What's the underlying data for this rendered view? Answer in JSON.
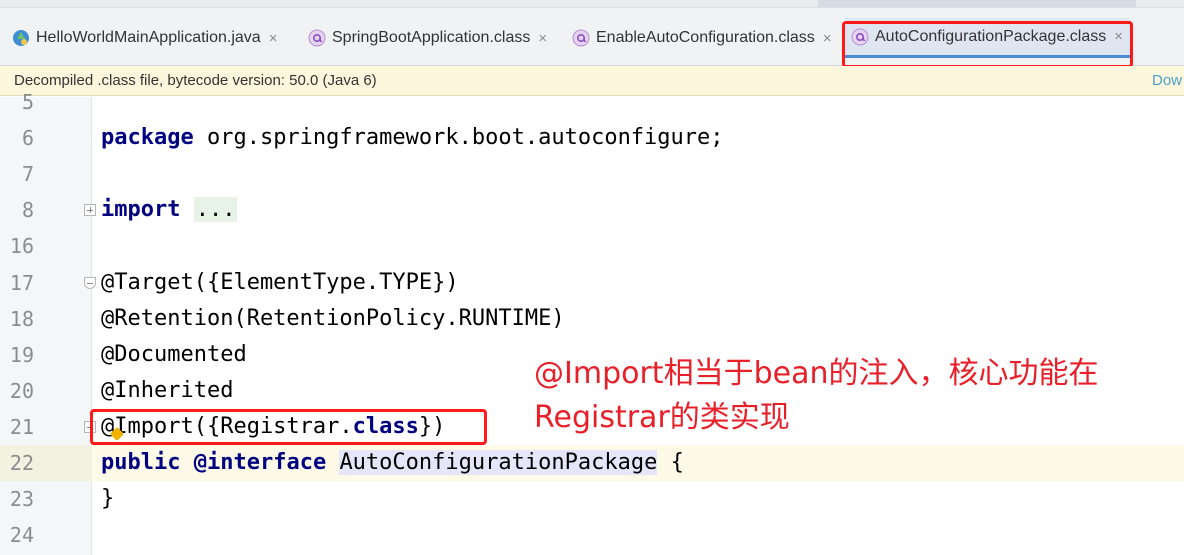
{
  "tabs": [
    {
      "label": "HelloWorldMainApplication.java",
      "icon": "java-class-icon",
      "active": false
    },
    {
      "label": "SpringBootApplication.class",
      "icon": "annotation-icon",
      "active": false
    },
    {
      "label": "EnableAutoConfiguration.class",
      "icon": "annotation-icon",
      "active": false
    },
    {
      "label": "AutoConfigurationPackage.class",
      "icon": "annotation-icon",
      "active": true
    }
  ],
  "close_glyph": "×",
  "banner": {
    "text": "Decompiled .class file, bytecode version: 50.0 (Java 6)",
    "link": "Dow"
  },
  "code": {
    "line_numbers": [
      "5",
      "6",
      "7",
      "8",
      "16",
      "17",
      "18",
      "19",
      "20",
      "21",
      "22",
      "23",
      "24"
    ],
    "package_kw": "package",
    "package_name": " org.springframework.boot.autoconfigure;",
    "import_kw": "import",
    "import_folded": "...",
    "target": "@Target({ElementType.TYPE})",
    "retention": "@Retention(RetentionPolicy.RUNTIME)",
    "documented": "@Documented",
    "inherited": "@Inherited",
    "import_anno_start": "@Import({Registrar.",
    "class_kw": "class",
    "import_anno_end": "})",
    "public_kw": "public",
    "interface_kw": "@interface",
    "interface_name": "AutoConfigurationPackage",
    "open_brace": " {",
    "close_brace": "}"
  },
  "annotation": {
    "line1": "@Import相当于bean的注入，核心功能在",
    "line2": "Registrar的类实现"
  },
  "colors": {
    "highlight": "#ff1a1a",
    "annotation_text": "#e8202a",
    "keyword": "#000080"
  }
}
